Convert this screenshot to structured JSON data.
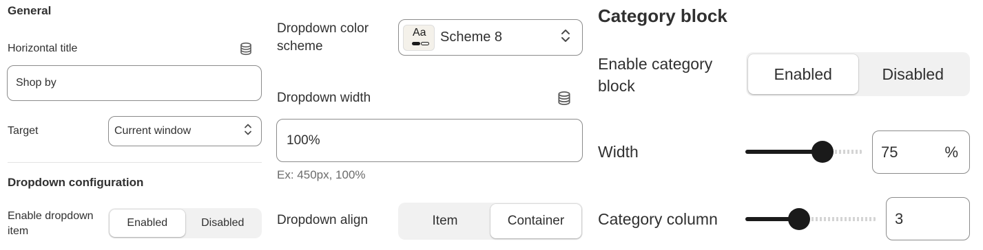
{
  "general": {
    "heading": "General",
    "horizontal_title_label": "Horizontal title",
    "horizontal_title_value": "Shop by",
    "target_label": "Target",
    "target_value": "Current window"
  },
  "dropdown_configuration": {
    "heading": "Dropdown configuration",
    "enable_label": "Enable dropdown item",
    "enable_options": [
      "Enabled",
      "Disabled"
    ],
    "enable_selected": "Enabled"
  },
  "dropdown": {
    "color_scheme_label": "Dropdown color scheme",
    "color_scheme_swatch_text": "Aa",
    "color_scheme_value": "Scheme 8",
    "width_label": "Dropdown width",
    "width_value": "100%",
    "width_help": "Ex: 450px, 100%",
    "align_label": "Dropdown align",
    "align_options": [
      "Item",
      "Container"
    ],
    "align_selected": "Container"
  },
  "category_block": {
    "heading": "Category block",
    "enable_label": "Enable category block",
    "enable_options": [
      "Enabled",
      "Disabled"
    ],
    "enable_selected": "Enabled",
    "width_label": "Width",
    "width_value": "75",
    "width_unit": "%",
    "width_fraction": 0.75,
    "column_label": "Category column",
    "column_value": "3"
  },
  "icons": [
    "database-icon",
    "chevron-up-down-icon"
  ],
  "colors": {
    "text": "#303030",
    "border": "#8a8a8a",
    "segment_bg": "#f1f1f1",
    "slider": "#1a1a1a",
    "help_text": "#6b6b6b"
  }
}
